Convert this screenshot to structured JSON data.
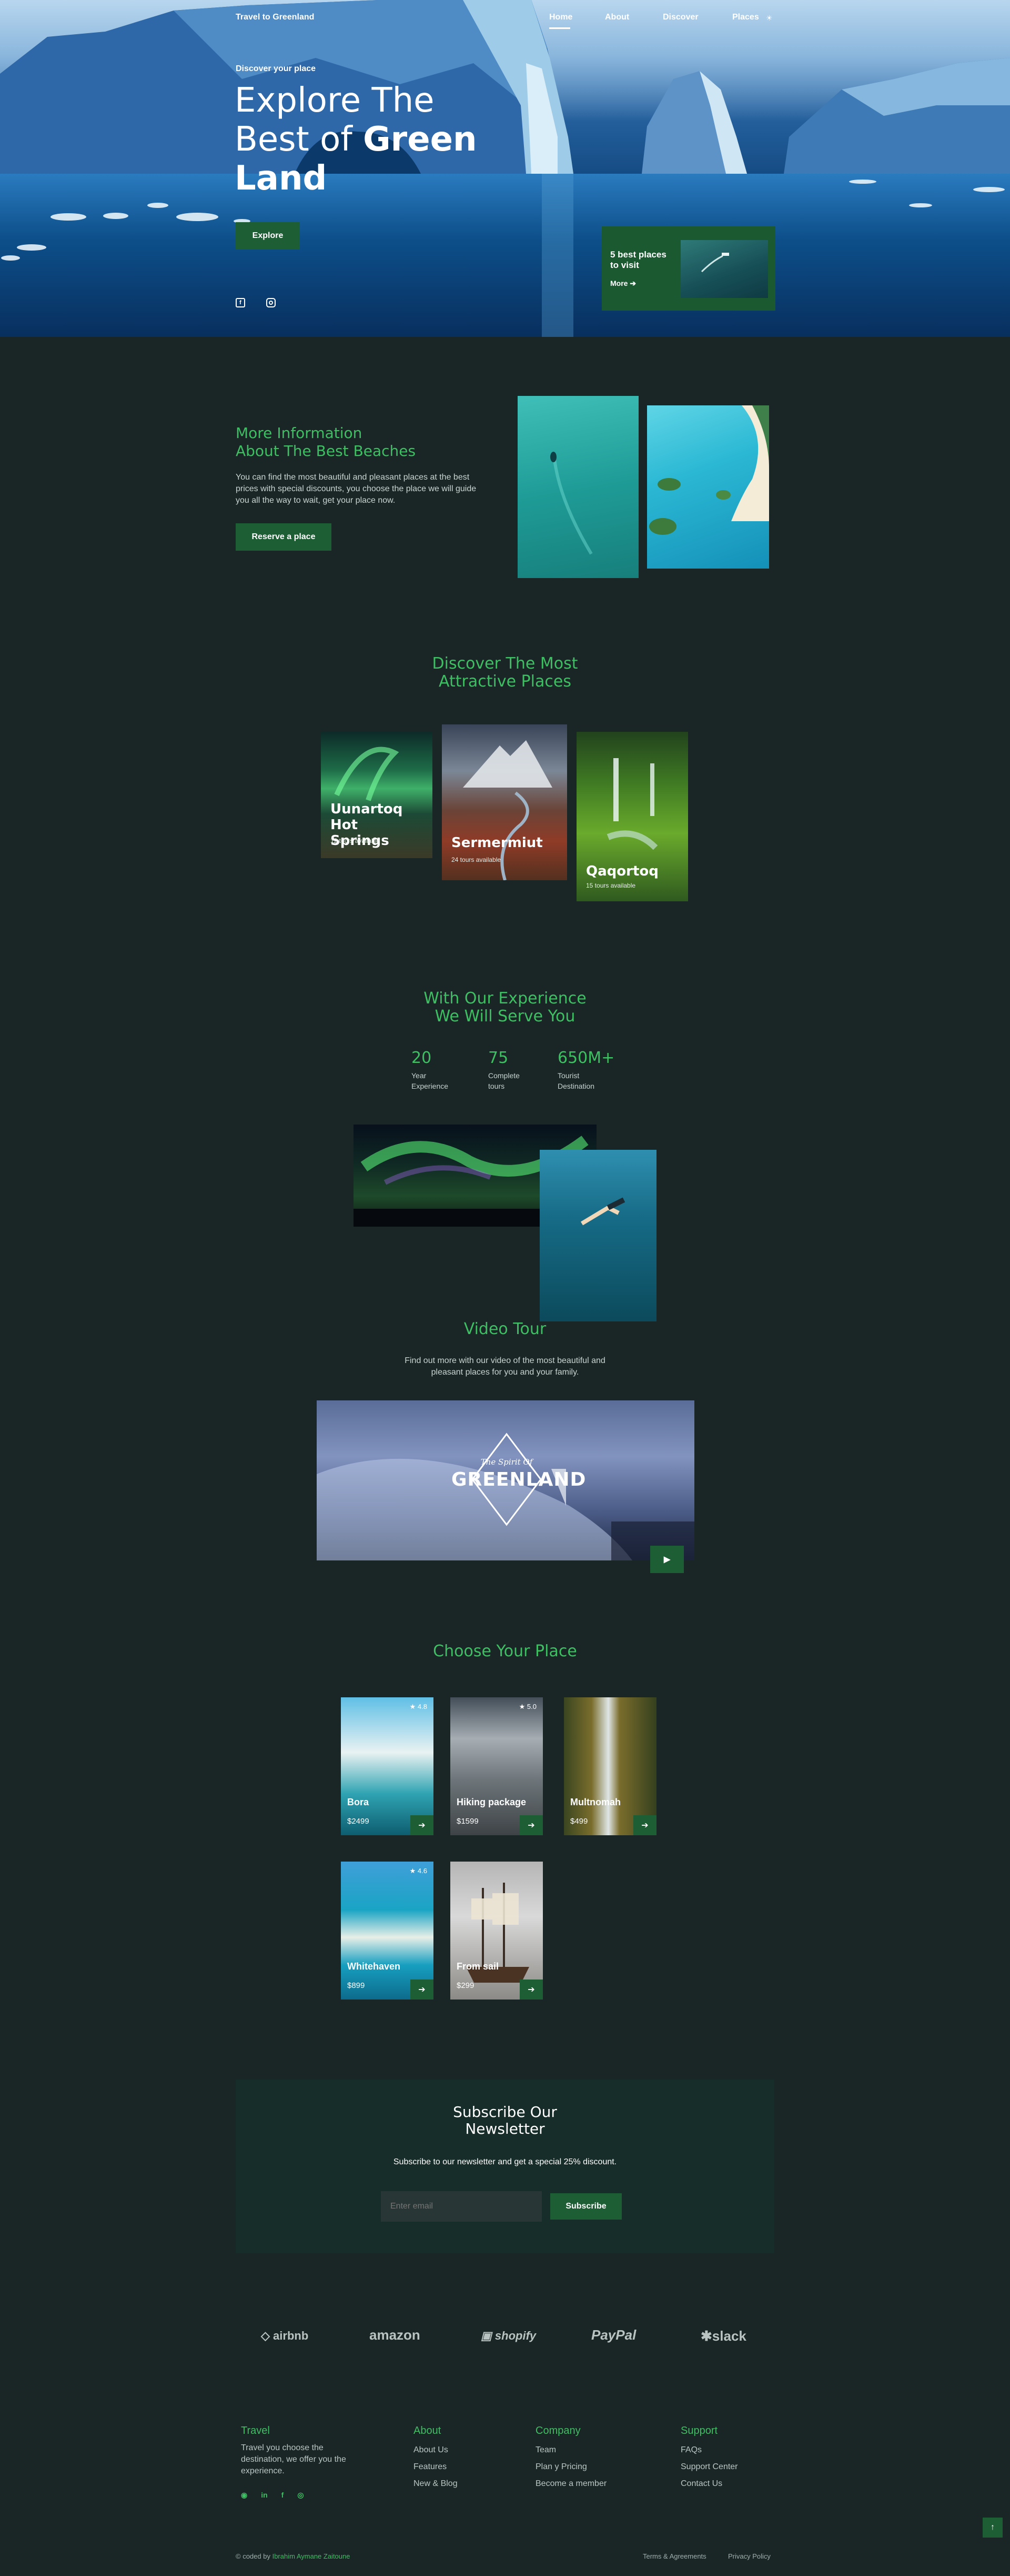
{
  "nav": {
    "brand": "Travel to Greenland",
    "links": [
      "Home",
      "About",
      "Discover",
      "Places"
    ]
  },
  "hero": {
    "eyebrow": "Discover your place",
    "title_line1": "Explore The",
    "title_line2_a": "Best of ",
    "title_line2_b": "Green",
    "title_line3": "Land",
    "cta": "Explore",
    "promo_title": "5 best places to visit",
    "promo_more": "More"
  },
  "info": {
    "title_line1": "More Information",
    "title_line2": "About The Best Beaches",
    "text": "You can find the most beautiful and pleasant places at the best prices with special discounts, you choose the place we will guide you all the way to wait, get your place now.",
    "cta": "Reserve a place"
  },
  "discover": {
    "title_line1": "Discover The Most",
    "title_line2": "Attractive Places",
    "cards": [
      {
        "name_line1": "Uunartoq Hot",
        "name_line2": "Springs",
        "sub": "12 tours available"
      },
      {
        "name_line1": "Sermermiut",
        "name_line2": "",
        "sub": "24 tours available"
      },
      {
        "name_line1": "Qaqortoq",
        "name_line2": "",
        "sub": "15 tours available"
      }
    ]
  },
  "experience": {
    "title_line1": "With Our Experience",
    "title_line2": "We Will Serve You",
    "stats": [
      {
        "num": "20",
        "l1": "Year",
        "l2": "Experience"
      },
      {
        "num": "75",
        "l1": "Complete",
        "l2": "tours"
      },
      {
        "num": "650M+",
        "l1": "Tourist",
        "l2": "Destination"
      }
    ]
  },
  "video": {
    "title": "Video Tour",
    "text_line1": "Find out more with our video of the most beautiful and",
    "text_line2": "pleasant places for you and your family.",
    "logo_top": "The Spirit Of",
    "logo_main": "GREENLAND"
  },
  "choose": {
    "title": "Choose Your Place",
    "items": [
      {
        "name": "Bora",
        "price": "$2499",
        "rating": "4.8"
      },
      {
        "name": "Hiking package",
        "price": "$1599",
        "rating": "5.0"
      },
      {
        "name": "Multnomah",
        "price": "$499",
        "rating": ""
      },
      {
        "name": "Whitehaven",
        "price": "$899",
        "rating": "4.6"
      },
      {
        "name": "From sail",
        "price": "$299",
        "rating": ""
      }
    ]
  },
  "newsletter": {
    "title_line1": "Subscribe Our",
    "title_line2": "Newsletter",
    "text": "Subscribe to our newsletter and get a special 25% discount.",
    "placeholder": "Enter email",
    "button": "Subscribe"
  },
  "brands": [
    "airbnb",
    "amazon",
    "shopify",
    "PayPal",
    "slack"
  ],
  "footer": {
    "travel_title": "Travel",
    "travel_text": "Travel you choose the destination, we offer you the experience.",
    "about_title": "About",
    "about_links": [
      "About Us",
      "Features",
      "New & Blog"
    ],
    "company_title": "Company",
    "company_links": [
      "Team",
      "Plan y Pricing",
      "Become a member"
    ],
    "support_title": "Support",
    "support_links": [
      "FAQs",
      "Support Center",
      "Contact Us"
    ],
    "credit_prefix": "© coded by ",
    "credit_name": "Ibrahim Aymane Zaitoune",
    "terms": "Terms & Agreements",
    "privacy": "Privacy Policy"
  },
  "colors": {
    "accent": "#3fbf63",
    "button": "#1d5e34",
    "background": "#1a2625"
  }
}
